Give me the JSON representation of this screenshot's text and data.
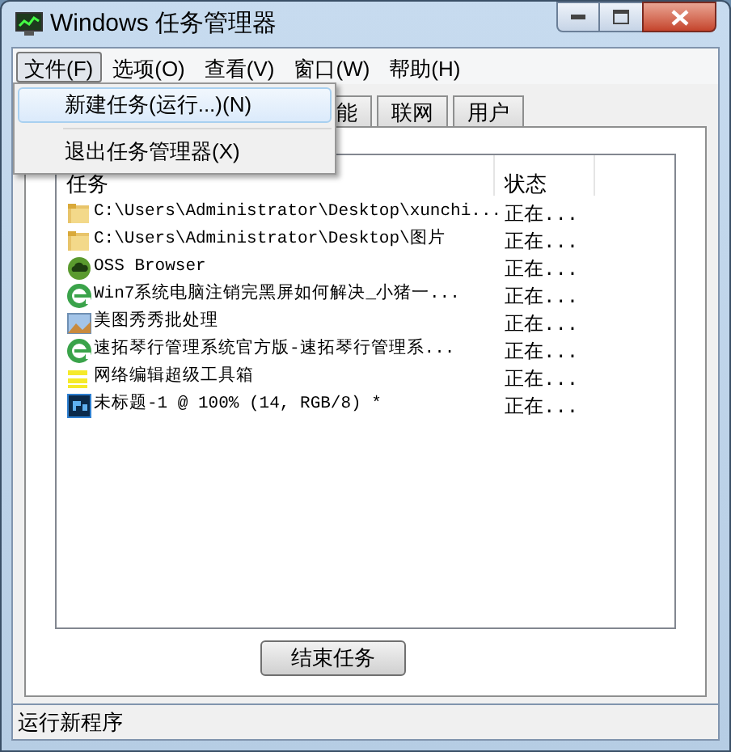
{
  "window": {
    "title": "Windows 任务管理器"
  },
  "menubar": [
    {
      "label": "文件(F)",
      "selected": true
    },
    {
      "label": "选项(O)",
      "selected": false
    },
    {
      "label": "查看(V)",
      "selected": false
    },
    {
      "label": "窗口(W)",
      "selected": false
    },
    {
      "label": "帮助(H)",
      "selected": false
    }
  ],
  "menu": [
    {
      "label": "新建任务(运行...)(N)",
      "selected": true
    },
    {
      "label": "退出任务管理器(X)",
      "selected": false
    }
  ],
  "tabs": [
    {
      "label": "能",
      "selected": false
    },
    {
      "label": "联网",
      "selected": false
    },
    {
      "label": "用户",
      "selected": false
    }
  ],
  "table": {
    "columns": [
      "任务",
      "状态"
    ],
    "rows": [
      {
        "kind": "folder",
        "task": "C:\\Users\\Administrator\\Desktop\\xunchi...",
        "status": "正在..."
      },
      {
        "kind": "folder",
        "task": "C:\\Users\\Administrator\\Desktop\\图片",
        "status": "正在..."
      },
      {
        "kind": "cloud",
        "task": "OSS Browser",
        "status": "正在..."
      },
      {
        "kind": "browser",
        "task": "Win7系统电脑注销完黑屏如何解决_小猪一...",
        "status": "正在..."
      },
      {
        "kind": "image",
        "task": "美图秀秀批处理",
        "status": "正在..."
      },
      {
        "kind": "browser",
        "task": "速拓琴行管理系统官方版-速拓琴行管理系...",
        "status": "正在..."
      },
      {
        "kind": "toolbox",
        "task": "网络编辑超级工具箱",
        "status": "正在..."
      },
      {
        "kind": "photoshop",
        "task": "未标题-1 @ 100% (14, RGB/8) *",
        "status": "正在..."
      }
    ]
  },
  "buttons": [
    "结束任务"
  ],
  "status_bar": "运行新程序"
}
